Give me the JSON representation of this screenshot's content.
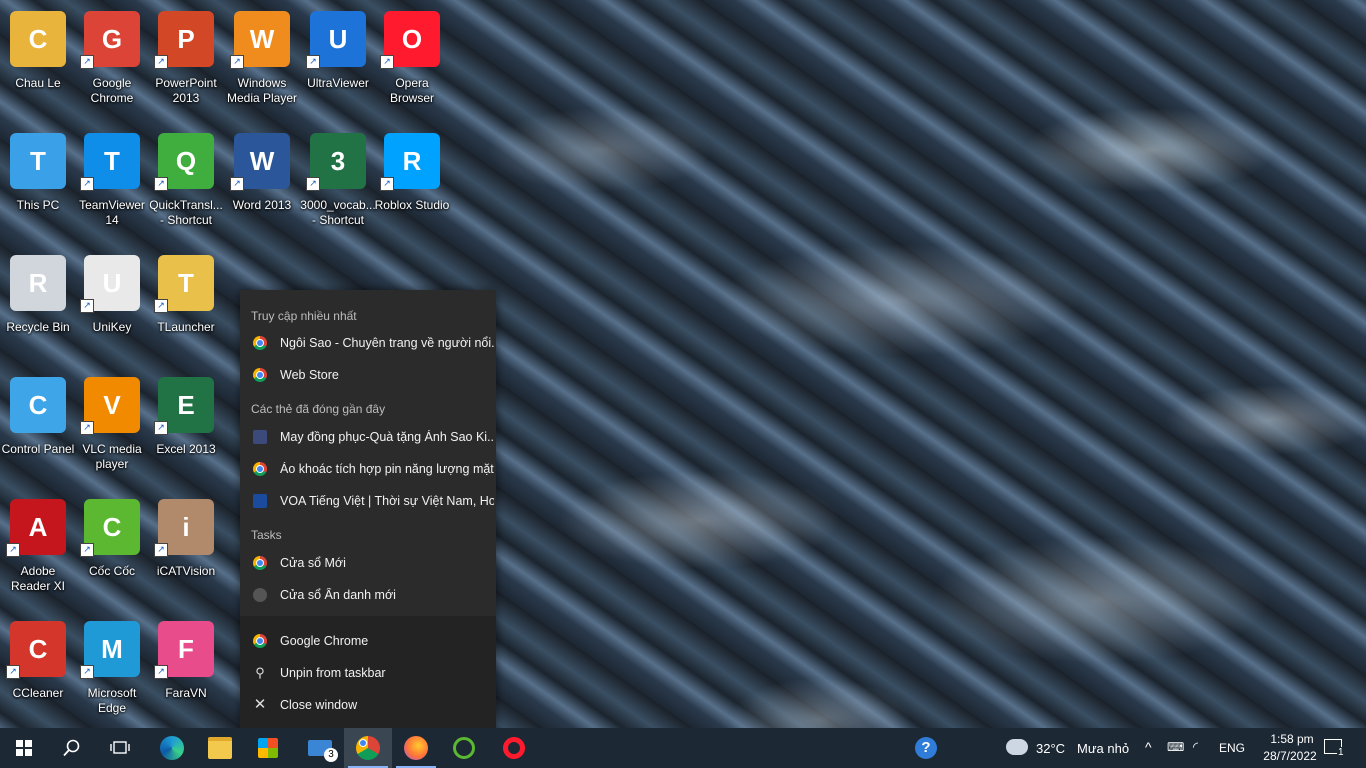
{
  "desktop_icons": [
    {
      "label": "Chau Le",
      "icon": "user-folder-icon",
      "color": "#e8b43c"
    },
    {
      "label": "Google Chrome",
      "icon": "chrome-icon",
      "color": "#db4437"
    },
    {
      "label": "PowerPoint 2013",
      "icon": "powerpoint-icon",
      "color": "#d24726"
    },
    {
      "label": "Windows Media Player",
      "icon": "media-player-icon",
      "color": "#f08c1e"
    },
    {
      "label": "UltraViewer",
      "icon": "ultraviewer-icon",
      "color": "#1e73d8"
    },
    {
      "label": "Opera Browser",
      "icon": "opera-icon",
      "color": "#ff1b2d"
    },
    {
      "label": "This PC",
      "icon": "computer-icon",
      "color": "#3aa0e8"
    },
    {
      "label": "TeamViewer 14",
      "icon": "teamviewer-icon",
      "color": "#0e8ee9"
    },
    {
      "label": "QuickTransl... - Shortcut",
      "icon": "checkmark-icon",
      "color": "#3fae3f"
    },
    {
      "label": "Word 2013",
      "icon": "word-icon",
      "color": "#2b579a"
    },
    {
      "label": "3000_vocab... - Shortcut",
      "icon": "excel-file-icon",
      "color": "#217346"
    },
    {
      "label": "Roblox Studio",
      "icon": "roblox-studio-icon",
      "color": "#00a2ff"
    },
    {
      "label": "Recycle Bin",
      "icon": "recycle-bin-icon",
      "color": "#d0d6dc"
    },
    {
      "label": "UniKey",
      "icon": "unikey-icon",
      "color": "#e9e9e9"
    },
    {
      "label": "TLauncher",
      "icon": "folder-icon",
      "color": "#e8c04a"
    },
    {
      "label": "Control Panel",
      "icon": "control-panel-icon",
      "color": "#3ea6e8"
    },
    {
      "label": "VLC media player",
      "icon": "vlc-icon",
      "color": "#f28a00"
    },
    {
      "label": "Excel 2013",
      "icon": "excel-icon",
      "color": "#217346"
    },
    {
      "label": "Adobe Reader XI",
      "icon": "adobe-reader-icon",
      "color": "#c4161c"
    },
    {
      "label": "Cốc Cốc",
      "icon": "coccoc-icon",
      "color": "#5cb831"
    },
    {
      "label": "iCATVision",
      "icon": "icatvision-icon",
      "color": "#b08a6a"
    },
    {
      "label": "CCleaner",
      "icon": "ccleaner-icon",
      "color": "#d4362c"
    },
    {
      "label": "Microsoft Edge",
      "icon": "edge-icon",
      "color": "#1f9ad6"
    },
    {
      "label": "FaraVN",
      "icon": "faravn-icon",
      "color": "#e84c8b"
    }
  ],
  "jumplist": {
    "section_frequent": "Truy cập nhiều nhất",
    "section_recent": "Các thẻ đã đóng gần đây",
    "section_tasks": "Tasks",
    "frequent": [
      {
        "label": "Ngôi Sao - Chuyên trang về người nổi...",
        "icon": "chrome-icon"
      },
      {
        "label": "Web Store",
        "icon": "chrome-icon"
      }
    ],
    "recent": [
      {
        "label": "May đồng phục-Quà tặng Ánh Sao Ki...",
        "icon": "site-icon"
      },
      {
        "label": "Áo khoác tích hợp pin năng lượng mặt...",
        "icon": "chrome-icon"
      },
      {
        "label": "VOA Tiếng Việt | Thời sự Việt Nam, Ho...",
        "icon": "voa-icon"
      }
    ],
    "tasks": [
      {
        "label": "Cửa sổ Mới",
        "icon": "chrome-icon"
      },
      {
        "label": "Cửa sổ Ẩn danh mới",
        "icon": "incognito-icon"
      }
    ],
    "footer": [
      {
        "label": "Google Chrome",
        "icon": "chrome-icon"
      },
      {
        "label": "Unpin from taskbar",
        "icon": "unpin-icon"
      },
      {
        "label": "Close window",
        "icon": "close-icon"
      }
    ]
  },
  "taskbar": {
    "mail_badge": "3",
    "weather_temp": "32°C",
    "weather_text": "Mưa nhỏ",
    "language": "ENG",
    "time": "1:58 pm",
    "date": "28/7/2022",
    "notification_count": "1"
  }
}
